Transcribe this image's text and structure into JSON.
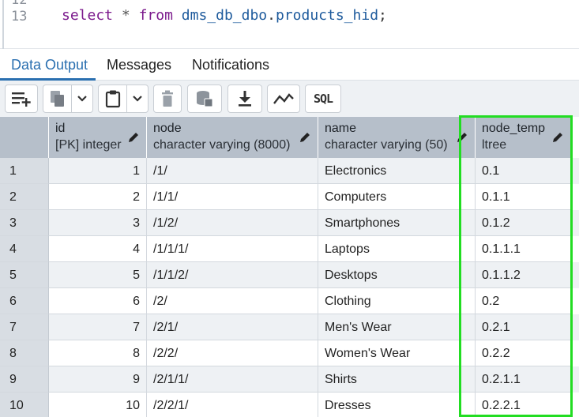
{
  "editor": {
    "prev_line_number": "12",
    "line_number": "13",
    "code": {
      "kw_select": "select",
      "star": "*",
      "kw_from": "from",
      "schema": "dms_db_dbo",
      "dot": ".",
      "table": "products_hid",
      "semicolon": ";"
    }
  },
  "tabs": [
    {
      "label": "Data Output",
      "active": true
    },
    {
      "label": "Messages",
      "active": false
    },
    {
      "label": "Notifications",
      "active": false
    }
  ],
  "toolbar": {
    "buttons": [
      {
        "icon": "add-row-icon"
      },
      {
        "icon": "copy-icon"
      },
      {
        "icon": "chevron-down-icon"
      },
      {
        "icon": "paste-icon"
      },
      {
        "icon": "chevron-down-icon"
      },
      {
        "icon": "delete-icon"
      },
      {
        "icon": "save-data-icon"
      },
      {
        "icon": "download-icon"
      },
      {
        "icon": "graph-icon"
      },
      {
        "icon": "sql-icon",
        "label": "SQL"
      }
    ]
  },
  "grid": {
    "columns": [
      {
        "name": "id",
        "type": "[PK] integer"
      },
      {
        "name": "node",
        "type": "character varying (8000)"
      },
      {
        "name": "name",
        "type": "character varying (50)"
      },
      {
        "name": "node_temp",
        "type": "ltree"
      }
    ],
    "rows": [
      {
        "n": "1",
        "id": "1",
        "node": "/1/",
        "name": "Electronics",
        "node_temp": "0.1"
      },
      {
        "n": "2",
        "id": "2",
        "node": "/1/1/",
        "name": "Computers",
        "node_temp": "0.1.1"
      },
      {
        "n": "3",
        "id": "3",
        "node": "/1/2/",
        "name": "Smartphones",
        "node_temp": "0.1.2"
      },
      {
        "n": "4",
        "id": "4",
        "node": "/1/1/1/",
        "name": "Laptops",
        "node_temp": "0.1.1.1"
      },
      {
        "n": "5",
        "id": "5",
        "node": "/1/1/2/",
        "name": "Desktops",
        "node_temp": "0.1.1.2"
      },
      {
        "n": "6",
        "id": "6",
        "node": "/2/",
        "name": "Clothing",
        "node_temp": "0.2"
      },
      {
        "n": "7",
        "id": "7",
        "node": "/2/1/",
        "name": "Men's Wear",
        "node_temp": "0.2.1"
      },
      {
        "n": "8",
        "id": "8",
        "node": "/2/2/",
        "name": "Women's Wear",
        "node_temp": "0.2.2"
      },
      {
        "n": "9",
        "id": "9",
        "node": "/2/1/1/",
        "name": "Shirts",
        "node_temp": "0.2.1.1"
      },
      {
        "n": "10",
        "id": "10",
        "node": "/2/2/1/",
        "name": "Dresses",
        "node_temp": "0.2.2.1"
      }
    ]
  },
  "colors": {
    "accent": "#2a6fb0",
    "highlight": "#22dd22",
    "header_bg": "#b6bfca"
  }
}
